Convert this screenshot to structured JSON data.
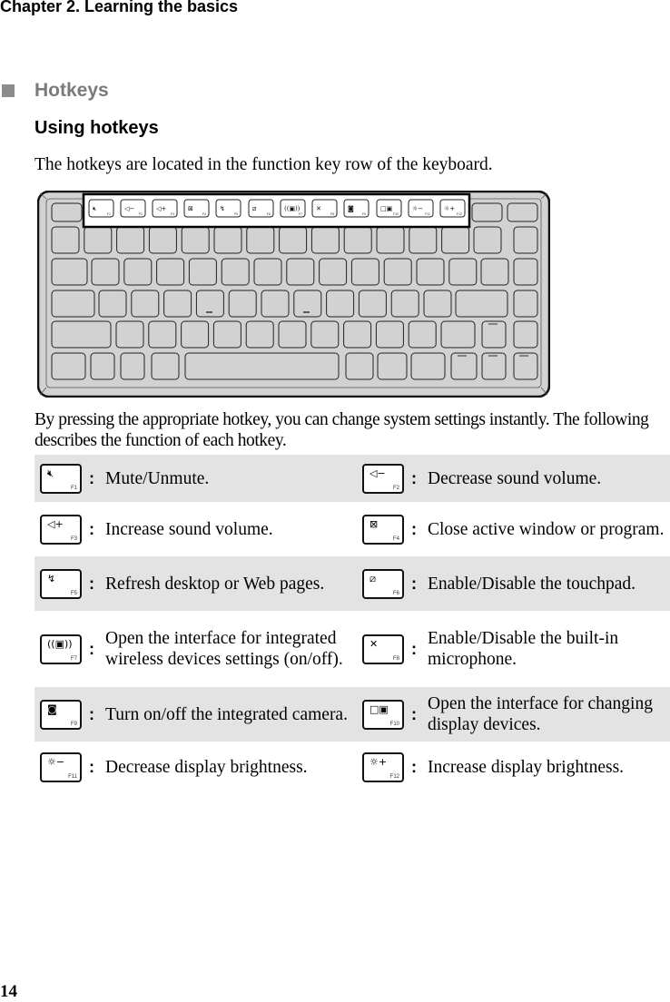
{
  "header": {
    "chapter_title": "Chapter 2. Learning the basics"
  },
  "section": {
    "title": "Hotkeys",
    "subtitle": "Using hotkeys"
  },
  "intro_text": "The hotkeys are located in the function key row of the keyboard.",
  "keyboard_figure": {
    "highlighted_row": "function key row",
    "function_keys": [
      {
        "key": "F1",
        "icon": "mute-icon"
      },
      {
        "key": "F2",
        "icon": "volume-down-icon"
      },
      {
        "key": "F3",
        "icon": "volume-up-icon"
      },
      {
        "key": "F4",
        "icon": "close-window-icon"
      },
      {
        "key": "F5",
        "icon": "refresh-icon"
      },
      {
        "key": "F6",
        "icon": "touchpad-icon"
      },
      {
        "key": "F7",
        "icon": "wireless-icon"
      },
      {
        "key": "F8",
        "icon": "microphone-icon"
      },
      {
        "key": "F9",
        "icon": "camera-icon"
      },
      {
        "key": "F10",
        "icon": "display-switch-icon"
      },
      {
        "key": "F11",
        "icon": "brightness-down-icon"
      },
      {
        "key": "F12",
        "icon": "brightness-up-icon"
      }
    ]
  },
  "description_text": "By pressing the appropriate hotkey, you can change system settings instantly. The following describes the function of each hotkey.",
  "hotkeys": [
    {
      "key": "F1",
      "glyph": "🔇︎",
      "icon": "mute-icon",
      "desc": "Mute/Unmute."
    },
    {
      "key": "F2",
      "glyph": "◁−",
      "icon": "volume-down-icon",
      "desc": "Decrease sound volume."
    },
    {
      "key": "F3",
      "glyph": "◁+",
      "icon": "volume-up-icon",
      "desc": "Increase sound volume."
    },
    {
      "key": "F4",
      "glyph": "⊠",
      "icon": "close-window-icon",
      "desc": "Close active window or program."
    },
    {
      "key": "F5",
      "glyph": "↯",
      "icon": "refresh-icon",
      "desc": "Refresh desktop or Web pages."
    },
    {
      "key": "F6",
      "glyph": "⧄",
      "icon": "touchpad-icon",
      "desc": "Enable/Disable the touchpad."
    },
    {
      "key": "F7",
      "glyph": "((▣))",
      "icon": "wireless-icon",
      "desc": "Open the interface for integrated wireless devices settings (on/off)."
    },
    {
      "key": "F8",
      "glyph": "✕",
      "icon": "microphone-icon",
      "desc": "Enable/Disable the built-in microphone."
    },
    {
      "key": "F9",
      "glyph": "◙",
      "icon": "camera-icon",
      "desc": "Turn on/off the integrated camera."
    },
    {
      "key": "F10",
      "glyph": "□▣",
      "icon": "display-switch-icon",
      "desc": "Open the interface for changing display devices."
    },
    {
      "key": "F11",
      "glyph": "☼−",
      "icon": "brightness-down-icon",
      "desc": "Decrease display brightness."
    },
    {
      "key": "F12",
      "glyph": "☼+",
      "icon": "brightness-up-icon",
      "desc": "Increase display brightness."
    }
  ],
  "separator": ":",
  "footer": {
    "page_number": "14"
  },
  "colors": {
    "row_shade": "#e3e3e3",
    "section_marker": "#8c8c8c",
    "keyboard_body": "#d2d2d2"
  }
}
